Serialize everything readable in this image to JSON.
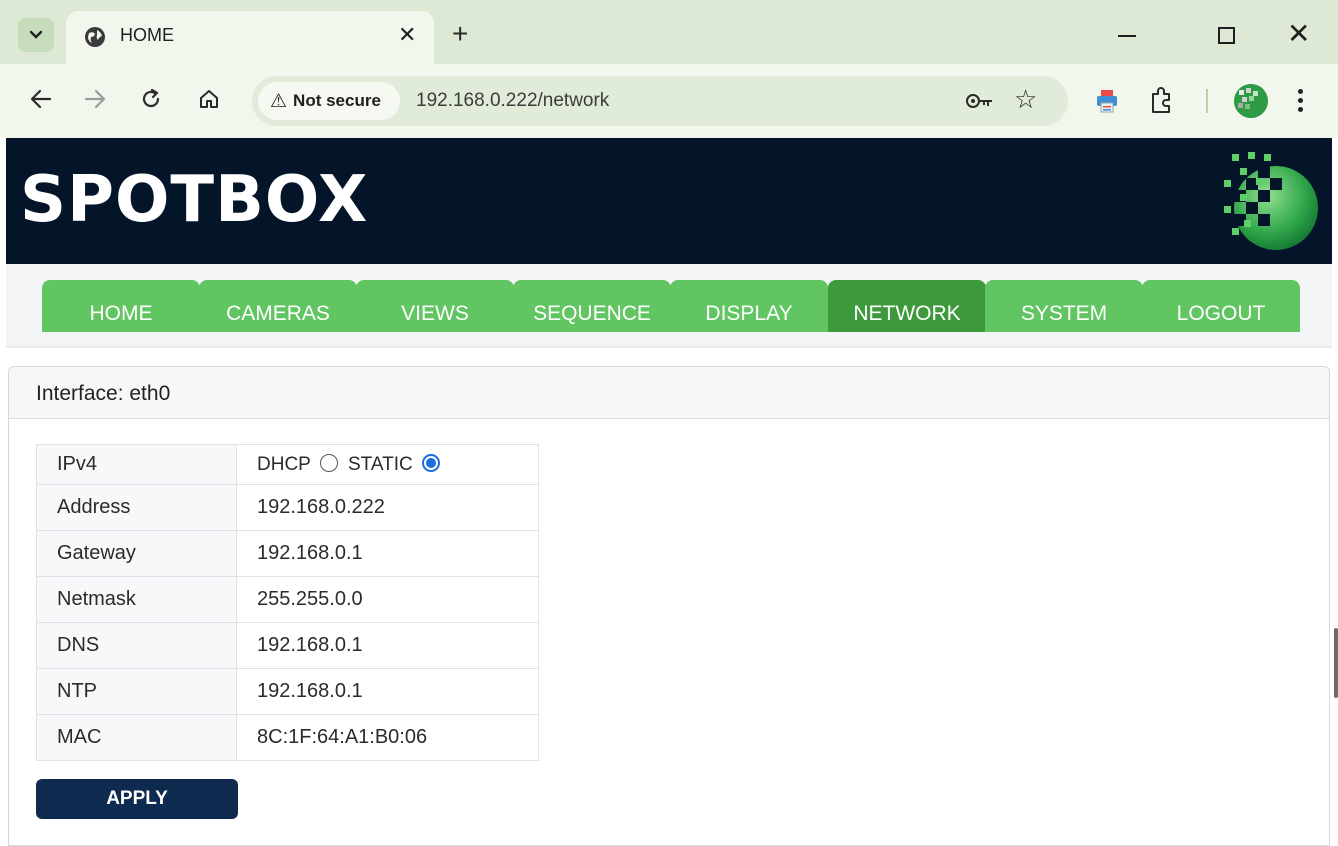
{
  "browser": {
    "tab_title": "HOME",
    "new_tab_label": "+",
    "close_tab_label": "✕",
    "security_label": "Not secure",
    "url": "192.168.0.222/network",
    "accent": "#dde9d4"
  },
  "site": {
    "brand": "SPOTBOX",
    "header_color": "#04152a",
    "nav_color": "#61c561",
    "nav_active_color": "#3d9a3c"
  },
  "nav": {
    "items": [
      {
        "label": "HOME"
      },
      {
        "label": "CAMERAS"
      },
      {
        "label": "VIEWS"
      },
      {
        "label": "SEQUENCE"
      },
      {
        "label": "DISPLAY"
      },
      {
        "label": "NETWORK",
        "active": true
      },
      {
        "label": "SYSTEM"
      },
      {
        "label": "LOGOUT"
      }
    ]
  },
  "panel": {
    "title": "Interface: eth0"
  },
  "network": {
    "ipv4": {
      "label": "IPv4",
      "option_dhcp": "DHCP",
      "option_static": "STATIC",
      "selected": "STATIC"
    },
    "rows": [
      {
        "label": "Address",
        "value": "192.168.0.222"
      },
      {
        "label": "Gateway",
        "value": "192.168.0.1"
      },
      {
        "label": "Netmask",
        "value": "255.255.0.0"
      },
      {
        "label": "DNS",
        "value": "192.168.0.1"
      },
      {
        "label": "NTP",
        "value": "192.168.0.1"
      },
      {
        "label": "MAC",
        "value": "8C:1F:64:A1:B0:06"
      }
    ]
  },
  "actions": {
    "apply_label": "APPLY"
  }
}
